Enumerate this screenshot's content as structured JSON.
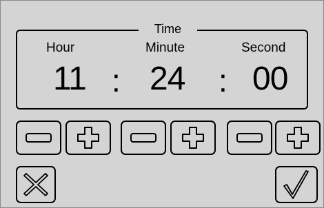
{
  "time": {
    "legend": "Time",
    "hour_label": "Hour",
    "minute_label": "Minute",
    "second_label": "Second",
    "hour_value": "11",
    "minute_value": "24",
    "second_value": "00",
    "separator": ":"
  },
  "icons": {
    "minus": "minus-icon",
    "plus": "plus-icon",
    "cancel": "x-icon",
    "confirm": "checkmark-icon"
  }
}
